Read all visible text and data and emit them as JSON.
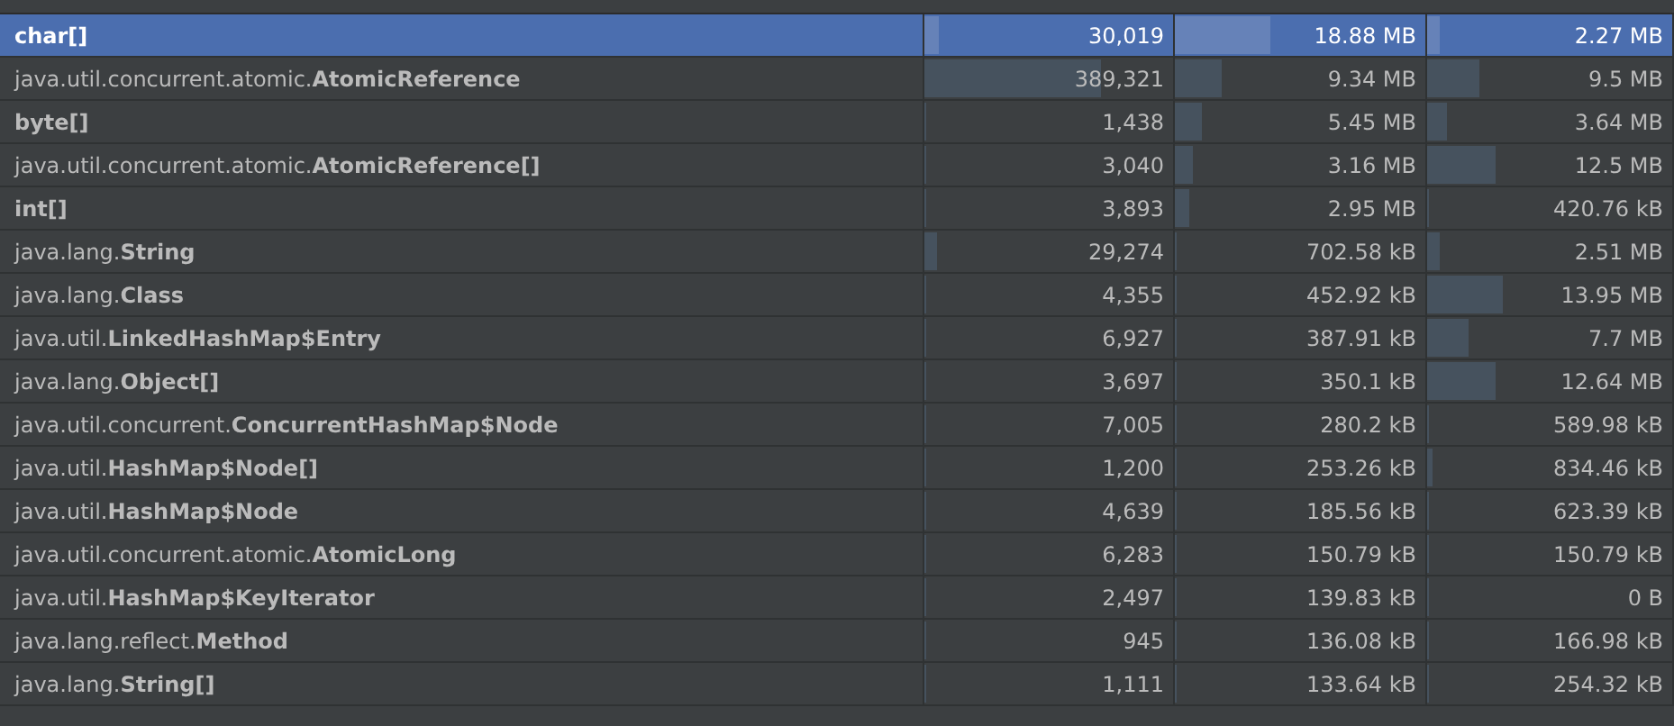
{
  "rows": [
    {
      "package": "",
      "name": "char[]",
      "count": {
        "text": "30,019",
        "level": 0.06
      },
      "shallow": {
        "text": "18.88 MB",
        "level": 0.38
      },
      "retained": {
        "text": "2.27 MB",
        "level": 0.05
      },
      "selected": true
    },
    {
      "package": "java.util.concurrent.atomic.",
      "name": "AtomicReference",
      "count": {
        "text": "389,321",
        "level": 0.71
      },
      "shallow": {
        "text": "9.34 MB",
        "level": 0.19
      },
      "retained": {
        "text": "9.5 MB",
        "level": 0.21
      },
      "selected": false
    },
    {
      "package": "",
      "name": "byte[]",
      "count": {
        "text": "1,438",
        "level": 0.01
      },
      "shallow": {
        "text": "5.45 MB",
        "level": 0.11
      },
      "retained": {
        "text": "3.64 MB",
        "level": 0.08
      },
      "selected": false
    },
    {
      "package": "java.util.concurrent.atomic.",
      "name": "AtomicReference[]",
      "count": {
        "text": "3,040",
        "level": 0.01
      },
      "shallow": {
        "text": "3.16 MB",
        "level": 0.07
      },
      "retained": {
        "text": "12.5 MB",
        "level": 0.28
      },
      "selected": false
    },
    {
      "package": "",
      "name": "int[]",
      "count": {
        "text": "3,893",
        "level": 0.01
      },
      "shallow": {
        "text": "2.95 MB",
        "level": 0.06
      },
      "retained": {
        "text": "420.76 kB",
        "level": 0.01
      },
      "selected": false
    },
    {
      "package": "java.lang.",
      "name": "String",
      "count": {
        "text": "29,274",
        "level": 0.05
      },
      "shallow": {
        "text": "702.58 kB",
        "level": 0.01
      },
      "retained": {
        "text": "2.51 MB",
        "level": 0.05
      },
      "selected": false
    },
    {
      "package": "java.lang.",
      "name": "Class",
      "count": {
        "text": "4,355",
        "level": 0.01
      },
      "shallow": {
        "text": "452.92 kB",
        "level": 0.01
      },
      "retained": {
        "text": "13.95 MB",
        "level": 0.31
      },
      "selected": false
    },
    {
      "package": "java.util.",
      "name": "LinkedHashMap$Entry",
      "count": {
        "text": "6,927",
        "level": 0.01
      },
      "shallow": {
        "text": "387.91 kB",
        "level": 0.01
      },
      "retained": {
        "text": "7.7 MB",
        "level": 0.17
      },
      "selected": false
    },
    {
      "package": "java.lang.",
      "name": "Object[]",
      "count": {
        "text": "3,697",
        "level": 0.01
      },
      "shallow": {
        "text": "350.1 kB",
        "level": 0.01
      },
      "retained": {
        "text": "12.64 MB",
        "level": 0.28
      },
      "selected": false
    },
    {
      "package": "java.util.concurrent.",
      "name": "ConcurrentHashMap$Node",
      "count": {
        "text": "7,005",
        "level": 0.01
      },
      "shallow": {
        "text": "280.2 kB",
        "level": 0.01
      },
      "retained": {
        "text": "589.98 kB",
        "level": 0.01
      },
      "selected": false
    },
    {
      "package": "java.util.",
      "name": "HashMap$Node[]",
      "count": {
        "text": "1,200",
        "level": 0.01
      },
      "shallow": {
        "text": "253.26 kB",
        "level": 0.01
      },
      "retained": {
        "text": "834.46 kB",
        "level": 0.02
      },
      "selected": false
    },
    {
      "package": "java.util.",
      "name": "HashMap$Node",
      "count": {
        "text": "4,639",
        "level": 0.01
      },
      "shallow": {
        "text": "185.56 kB",
        "level": 0.01
      },
      "retained": {
        "text": "623.39 kB",
        "level": 0.01
      },
      "selected": false
    },
    {
      "package": "java.util.concurrent.atomic.",
      "name": "AtomicLong",
      "count": {
        "text": "6,283",
        "level": 0.01
      },
      "shallow": {
        "text": "150.79 kB",
        "level": 0.01
      },
      "retained": {
        "text": "150.79 kB",
        "level": 0.01
      },
      "selected": false
    },
    {
      "package": "java.util.",
      "name": "HashMap$KeyIterator",
      "count": {
        "text": "2,497",
        "level": 0.01
      },
      "shallow": {
        "text": "139.83 kB",
        "level": 0.01
      },
      "retained": {
        "text": "0 B",
        "level": 0
      },
      "selected": false
    },
    {
      "package": "java.lang.reflect.",
      "name": "Method",
      "count": {
        "text": "945",
        "level": 0.01
      },
      "shallow": {
        "text": "136.08 kB",
        "level": 0.01
      },
      "retained": {
        "text": "166.98 kB",
        "level": 0.01
      },
      "selected": false
    },
    {
      "package": "java.lang.",
      "name": "String[]",
      "count": {
        "text": "1,111",
        "level": 0.01
      },
      "shallow": {
        "text": "133.64 kB",
        "level": 0.01
      },
      "retained": {
        "text": "254.32 kB",
        "level": 0.01
      },
      "selected": false
    }
  ]
}
